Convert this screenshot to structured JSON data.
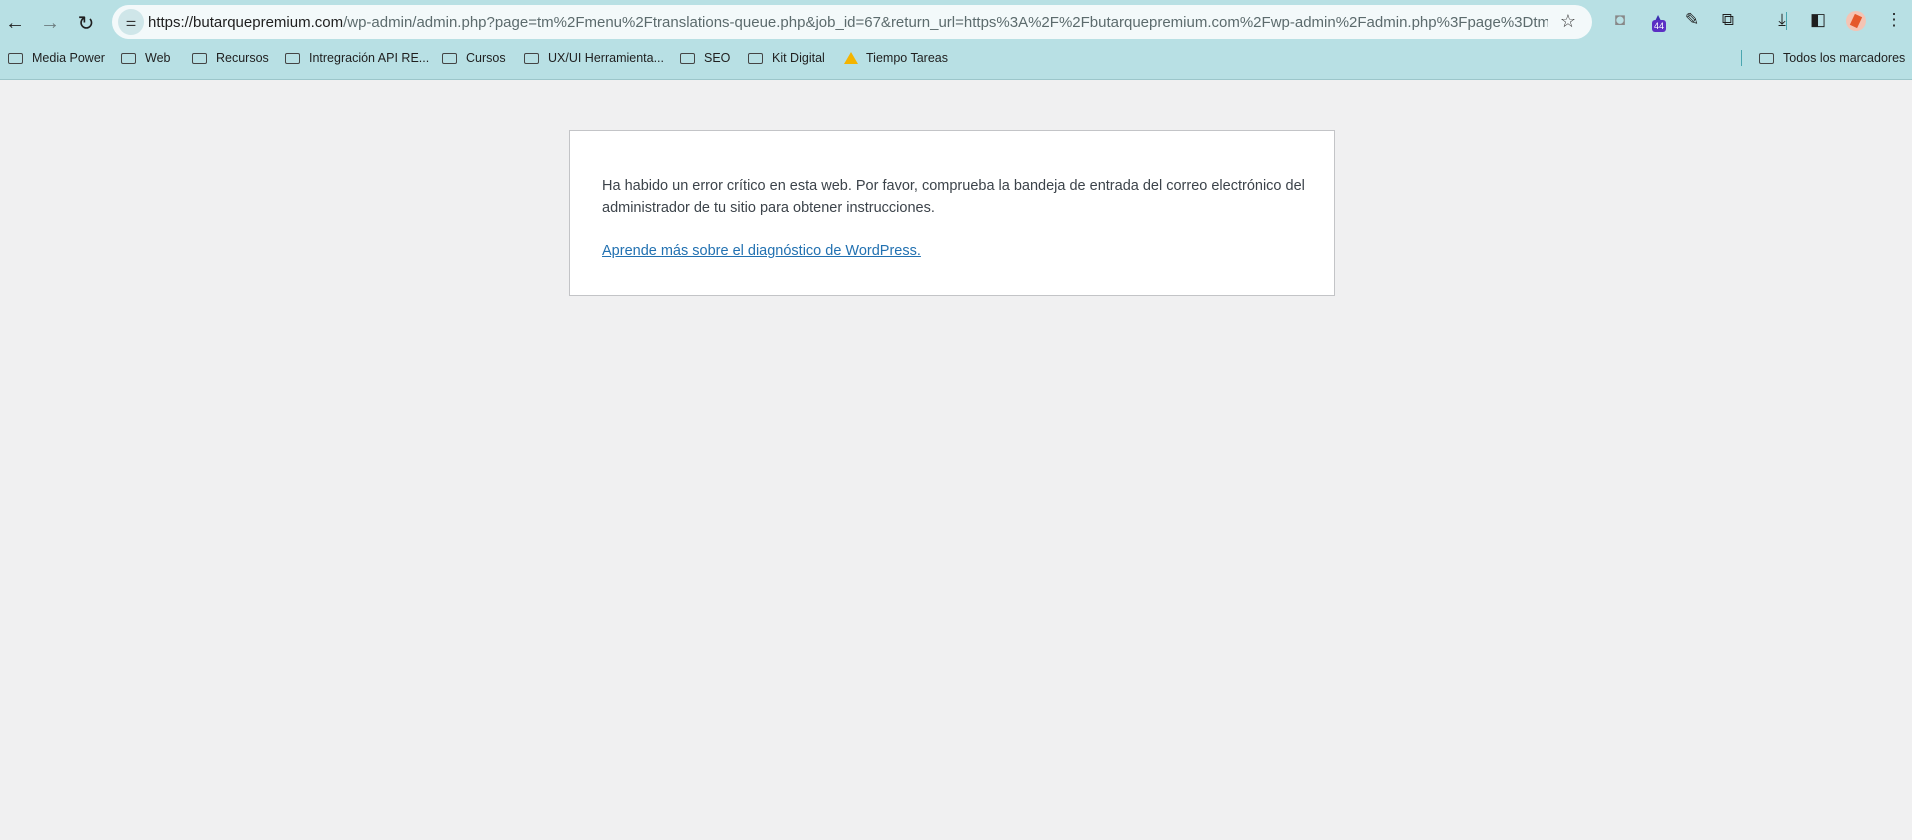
{
  "browser": {
    "url_host": "https://butarquepremium.com",
    "url_rest": "/wp-admin/admin.php?page=tm%2Fmenu%2Ftranslations-queue.php&job_id=67&return_url=https%3A%2F%2Fbutarquepremium.com%2Fwp-admin%2Fadmin.php%3Fpage%3Dtm%252Fmenu...",
    "extension_badge": "44",
    "bookmarks": [
      "Media Power",
      "Web",
      "Recursos",
      "Intregración API RE...",
      "Cursos",
      "UX/UI Herramienta...",
      "SEO",
      "Kit Digital",
      "Tiempo Tareas"
    ],
    "all_bookmarks": "Todos los marcadores"
  },
  "page": {
    "message": "Ha habido un error crítico en esta web. Por favor, comprueba la bandeja de entrada del correo electrónico del administrador de tu sitio para obtener instrucciones.",
    "link": "Aprende más sobre el diagnóstico de WordPress."
  }
}
